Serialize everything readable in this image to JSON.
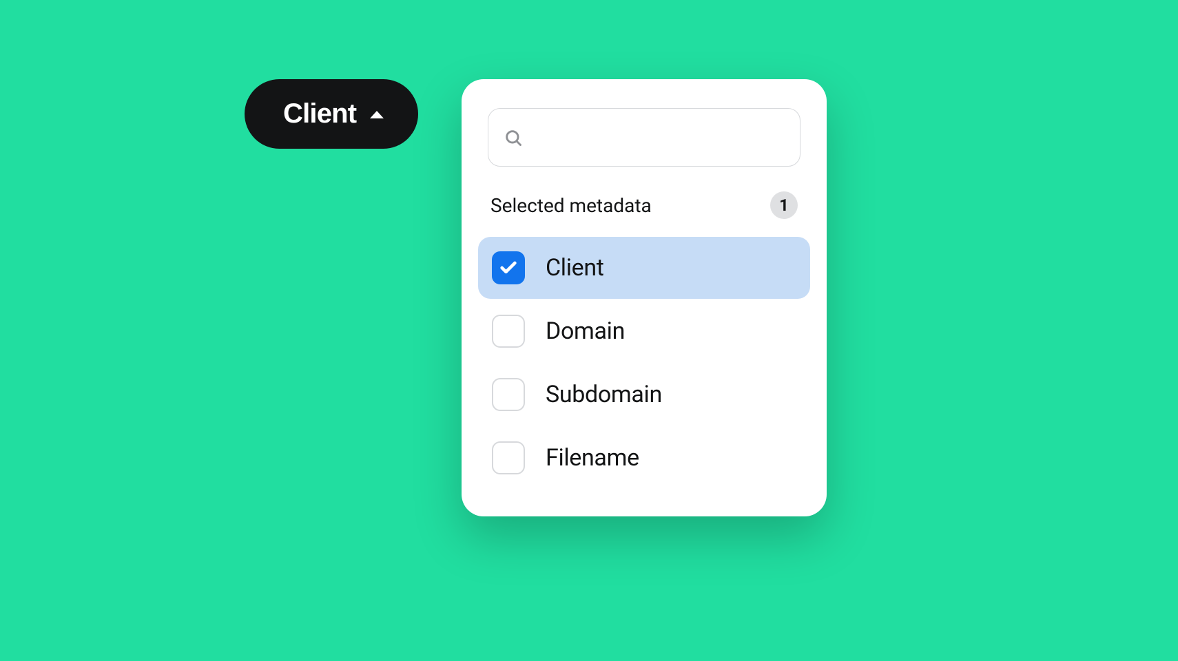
{
  "trigger": {
    "label": "Client"
  },
  "panel": {
    "search": {
      "placeholder": "",
      "value": ""
    },
    "section_title": "Selected metadata",
    "selected_count": "1",
    "options": [
      {
        "label": "Client",
        "checked": true
      },
      {
        "label": "Domain",
        "checked": false
      },
      {
        "label": "Subdomain",
        "checked": false
      },
      {
        "label": "Filename",
        "checked": false
      }
    ]
  }
}
